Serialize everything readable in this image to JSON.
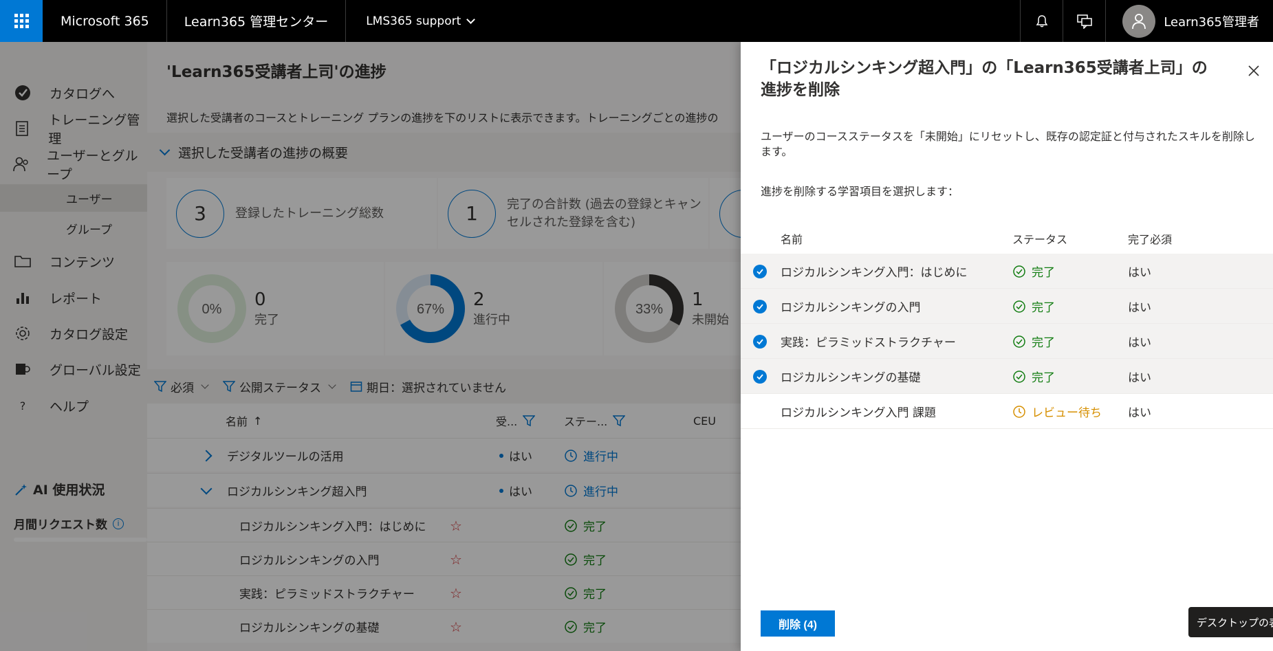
{
  "topbar": {
    "brand": "Microsoft 365",
    "admin_center": "Learn365 管理センター",
    "tenant": "LMS365 support",
    "user_name": "Learn365管理者"
  },
  "leftnav": {
    "items": [
      {
        "label": "カタログへ",
        "icon": "catalog-check-icon"
      },
      {
        "label": "トレーニング管理",
        "icon": "training-doc-icon"
      },
      {
        "label": "ユーザーとグループ",
        "icon": "users-icon"
      },
      {
        "label": "コンテンツ",
        "icon": "folder-icon"
      },
      {
        "label": "レポート",
        "icon": "bar-chart-icon"
      },
      {
        "label": "カタログ設定",
        "icon": "gear-icon"
      },
      {
        "label": "グローバル設定",
        "icon": "global-settings-icon"
      },
      {
        "label": "ヘルプ",
        "icon": "help-icon"
      }
    ],
    "sub_items": [
      "ユーザー",
      "グループ"
    ],
    "ai_title": "AI 使用状況",
    "request_title": "月間リクエスト数"
  },
  "main": {
    "title": "'Learn365受講者上司'の進捗",
    "description": "選択した受講者のコースとトレーニング プランの進捗を下のリストに表示できます。トレーニングごとの進捗の",
    "summary_header": "選択した受講者の進捗の概要",
    "stats": [
      {
        "value": "3",
        "label": "登録したトレーニング総数"
      },
      {
        "value": "1",
        "label": "完了の合計数 (過去の登録とキャンセルされた登録を含む)"
      }
    ],
    "donuts": [
      {
        "percent": "0%",
        "fraction": 0,
        "count": "0",
        "label": "完了",
        "color": "#107c10",
        "track": "#dff0dd"
      },
      {
        "percent": "67%",
        "fraction": 0.67,
        "count": "2",
        "label": "進行中",
        "color": "#0078d4",
        "track": "#deecf9"
      },
      {
        "percent": "33%",
        "fraction": 0.33,
        "count": "1",
        "label": "未開始",
        "color": "#323130",
        "track": "#d2d0ce"
      }
    ],
    "filters": {
      "required": "必須",
      "publish_status": "公開ステータス",
      "due_date": "期日：選択されていません"
    },
    "table_headers": {
      "name": "名前",
      "sort_arrow": "↑",
      "required": "受...",
      "status": "ステー...",
      "ceu": "CEU"
    },
    "rows": [
      {
        "name": "デジタルツールの活用",
        "required": "はい",
        "status": "進行中"
      },
      {
        "name": "ロジカルシンキング超入門",
        "required": "はい",
        "status": "進行中"
      },
      {
        "name": "ロジカルシンキング入門：はじめに",
        "status": "完了"
      },
      {
        "name": "ロジカルシンキングの入門",
        "status": "完了"
      },
      {
        "name": "実践：ピラミッドストラクチャー",
        "status": "完了"
      },
      {
        "name": "ロジカルシンキングの基礎",
        "status": "完了"
      }
    ]
  },
  "panel": {
    "title": "「ロジカルシンキング超入門」の「Learn365受講者上司」の進捗を削除",
    "description": "ユーザーのコースステータスを「未開始」にリセットし、既存の認定証と付与されたスキルを削除します。",
    "select_prompt": "進捗を削除する学習項目を選択します：",
    "headers": {
      "name": "名前",
      "status": "ステータス",
      "required": "完了必須"
    },
    "items": [
      {
        "name": "ロジカルシンキング入門：はじめに",
        "status": "完了",
        "required": "はい",
        "selected": true
      },
      {
        "name": "ロジカルシンキングの入門",
        "status": "完了",
        "required": "はい",
        "selected": true
      },
      {
        "name": "実践：ピラミッドストラクチャー",
        "status": "完了",
        "required": "はい",
        "selected": true
      },
      {
        "name": "ロジカルシンキングの基礎",
        "status": "完了",
        "required": "はい",
        "selected": true
      },
      {
        "name": "ロジカルシンキング入門 課題",
        "status": "レビュー待ち",
        "required": "はい",
        "selected": false
      }
    ],
    "delete_button": "削除 (4)"
  },
  "tooltip": "デスクトップの表示"
}
